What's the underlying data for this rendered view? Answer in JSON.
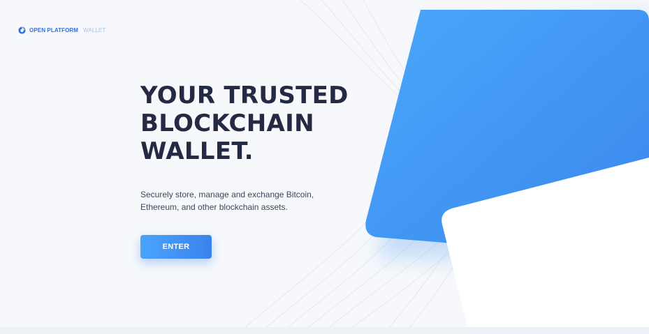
{
  "brand": {
    "name_strong": "OPEN PLATFORM",
    "name_light": "WALLET",
    "logo_icon": "circle-logo-icon"
  },
  "hero": {
    "headline": [
      "YOUR TRUSTED",
      "BLOCKCHAIN",
      "WALLET."
    ],
    "subtitle": [
      "Securely store, manage and exchange Bitcoin,",
      "Ethereum, and other blockchain assets."
    ],
    "cta_label": "ENTER"
  },
  "colors": {
    "accent": "#3a8ff0",
    "accent_light": "#4aa7fb",
    "headline": "#252a44",
    "background": "#f6f8fb"
  }
}
